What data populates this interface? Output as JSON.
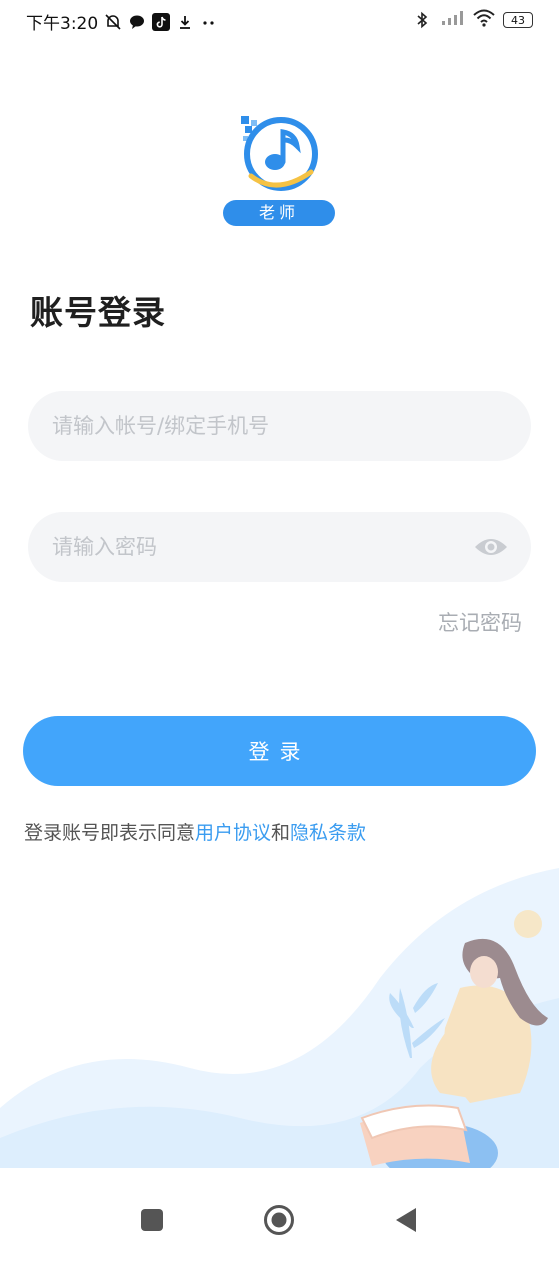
{
  "status_bar": {
    "time": "下午3:20",
    "battery": "43"
  },
  "logo": {
    "badge_text": "老师",
    "colors": {
      "primary": "#2f8eea",
      "accent": "#f5c244"
    }
  },
  "page": {
    "title": "账号登录"
  },
  "form": {
    "account_placeholder": "请输入帐号/绑定手机号",
    "account_value": "",
    "password_placeholder": "请输入密码",
    "password_value": "",
    "forgot_label": "忘记密码",
    "login_label": "登录"
  },
  "agreement": {
    "prefix": "登录账号即表示同意",
    "user_agreement": "用户协议",
    "and": "和",
    "privacy_policy": "隐私条款"
  },
  "nav_bar": {
    "icons": [
      "recent-apps-icon",
      "home-icon",
      "back-icon"
    ]
  },
  "colors": {
    "accent": "#42a5fb",
    "link": "#3a9cf0",
    "input_bg": "#f4f5f7"
  }
}
